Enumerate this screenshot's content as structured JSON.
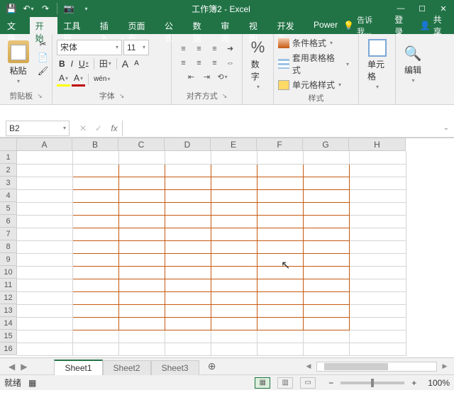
{
  "titlebar": {
    "title": "工作簿2 - Excel",
    "qat_save": "💾",
    "qat_undo": "↶",
    "qat_redo": "↷",
    "qat_cam": "📷",
    "win_min": "—",
    "win_max": "☐",
    "win_close": "✕"
  },
  "tabs": {
    "file": "文件",
    "home": "开始",
    "toolbox": "工具箱",
    "insert": "插入",
    "pagelayout": "页面布",
    "formulas": "公式",
    "data": "数据",
    "review": "审阅",
    "view": "视图",
    "developer": "开发工",
    "power": "Power",
    "tell_me": "告诉我...",
    "login": "登录",
    "share": "共享"
  },
  "ribbon": {
    "clipboard": {
      "label": "剪贴板",
      "paste": "粘贴",
      "cut": "✂",
      "copy": "📄",
      "painter": "🖌"
    },
    "font": {
      "label": "字体",
      "name": "宋体",
      "size": "11",
      "inc": "A",
      "dec": "A",
      "bold": "B",
      "italic": "I",
      "underline": "U",
      "border": "田",
      "fill": "A",
      "color": "A",
      "phonetic": "wén"
    },
    "alignment": {
      "label": "对齐方式",
      "wrap": "➜",
      "merge": "⇔"
    },
    "number": {
      "label": "数字",
      "pct": "%"
    },
    "styles": {
      "label": "样式",
      "cond": "条件格式",
      "table": "套用表格格式",
      "cell": "单元格样式"
    },
    "cells": {
      "label": "单元格"
    },
    "editing": {
      "label": "编辑"
    }
  },
  "namebox": {
    "ref": "B2",
    "dd": "▾",
    "cancel": "✕",
    "enter": "✓",
    "fx": "fx",
    "expand": "⌄"
  },
  "grid": {
    "cols": [
      "A",
      "B",
      "C",
      "D",
      "E",
      "F",
      "G",
      "H"
    ],
    "rows": [
      "1",
      "2",
      "3",
      "4",
      "5",
      "6",
      "7",
      "8",
      "9",
      "10",
      "11",
      "12",
      "13",
      "14",
      "15",
      "16"
    ],
    "bordered_range": "B2:G14",
    "border_color": "#c55a11",
    "cursor_cell": "F9"
  },
  "sheets": {
    "nav_prev": "◀",
    "nav_next": "▶",
    "tabs": [
      "Sheet1",
      "Sheet2",
      "Sheet3"
    ],
    "active": 0,
    "add": "⊕"
  },
  "status": {
    "ready": "就绪",
    "macro": "▦",
    "views": {
      "normal": "▦",
      "layout": "▥",
      "break": "▭"
    },
    "zoom_minus": "−",
    "zoom_plus": "+",
    "zoom": "100%"
  }
}
